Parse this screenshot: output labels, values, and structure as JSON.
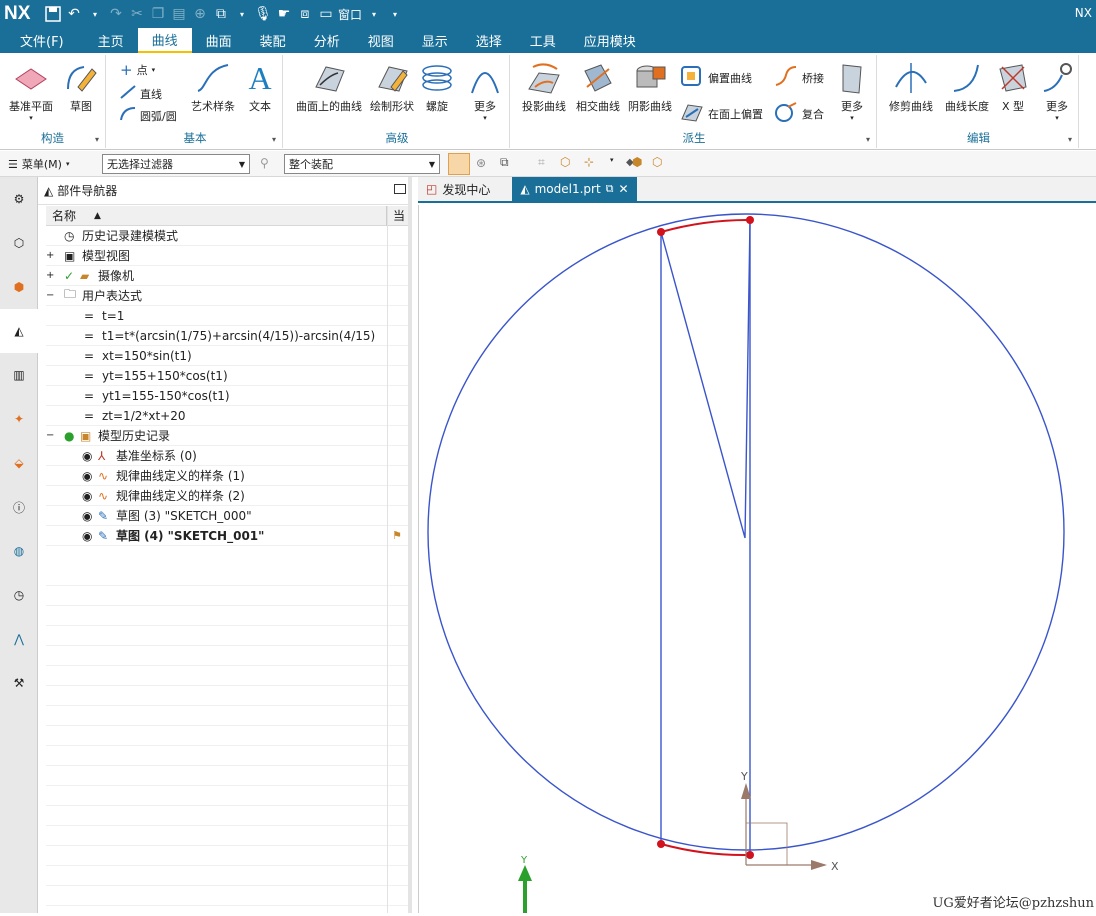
{
  "titlebar": {
    "logo": "NX",
    "window_menu": "窗口",
    "right_label": "NX"
  },
  "menubar": {
    "items": [
      "文件(F)",
      "主页",
      "曲线",
      "曲面",
      "装配",
      "分析",
      "视图",
      "显示",
      "选择",
      "工具",
      "应用模块"
    ],
    "active": "曲线"
  },
  "ribbon": {
    "groups": {
      "construct": "构造",
      "basic": "基本",
      "advanced": "高级",
      "derived": "派生",
      "edit": "编辑"
    },
    "buttons": {
      "datum_plane": "基准平面",
      "sketch": "草图",
      "point": "点",
      "line": "直线",
      "arc_circle": "圆弧/圆",
      "art_spline": "艺术样条",
      "text": "文本",
      "curve_on_surface": "曲面上的曲线",
      "sketch_shape": "绘制形状",
      "helix": "螺旋",
      "more1": "更多",
      "project_curve": "投影曲线",
      "intersect_curve": "相交曲线",
      "silhouette_curve": "阴影曲线",
      "offset_curve": "偏置曲线",
      "offset_in_face": "在面上偏置",
      "bridge": "桥接",
      "composite": "复合",
      "more2": "更多",
      "trim_curve": "修剪曲线",
      "curve_length": "曲线长度",
      "x_type": "X 型",
      "more3": "更多"
    }
  },
  "toolbar2": {
    "menu": "菜单(M)",
    "filter": "无选择过滤器",
    "assembly": "整个装配"
  },
  "navigator": {
    "title": "部件导航器",
    "col_name": "名称",
    "col_right": "当",
    "rows": [
      "历史记录建模模式",
      "模型视图",
      "摄像机",
      "用户表达式",
      "t=1",
      "t1=t*(arcsin(1/75)+arcsin(4/15))-arcsin(4/15)",
      "xt=150*sin(t1)",
      "yt=155+150*cos(t1)",
      "yt1=155-150*cos(t1)",
      "zt=1/2*xt+20",
      "模型历史记录",
      "基准坐标系 (0)",
      "规律曲线定义的样条 (1)",
      "规律曲线定义的样条 (2)",
      "草图 (3) \"SKETCH_000\"",
      "草图 (4) \"SKETCH_001\""
    ]
  },
  "tabs": {
    "discovery": "发现中心",
    "model": "model1.prt"
  },
  "viewport": {
    "axis_x": "X",
    "axis_y": "Y",
    "watermark": "UG爱好者论坛@pzhzshun"
  },
  "colors": {
    "brand": "#1a6f98",
    "curve": "#3a55cc",
    "arc": "#d2121c",
    "accent": "#f2c200"
  }
}
